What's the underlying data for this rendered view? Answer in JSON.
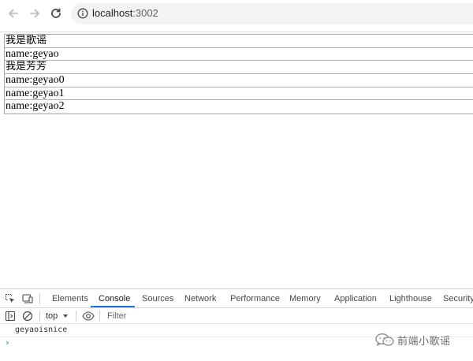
{
  "browser": {
    "url_host": "localhost",
    "url_port": ":3002"
  },
  "page": {
    "rows": [
      "我是歌谣",
      "name:geyao",
      "我是芳芳",
      "name:geyao0",
      "name:geyao1",
      "name:geyao2"
    ]
  },
  "devtools": {
    "tabs": [
      "Elements",
      "Console",
      "Sources",
      "Network",
      "Performance",
      "Memory",
      "Application",
      "Lighthouse",
      "Security"
    ],
    "active_tab": "Console",
    "context": "top",
    "filter_placeholder": "Filter",
    "log_output": "geyaoisnice",
    "prompt": "›",
    "accent_color": "#1a73e8"
  },
  "watermark": {
    "text": "前端小歌谣"
  }
}
